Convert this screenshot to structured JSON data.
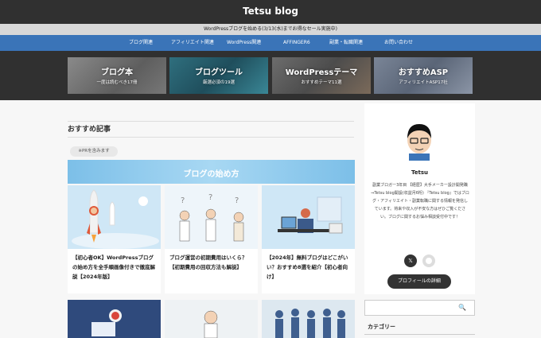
{
  "header": {
    "site_title": "Tetsu blog"
  },
  "sale_banner": "WordPressブログを始める(3/13(水)までお得なセール実施中)",
  "nav": [
    "ブログ関連",
    "アフィリエイト関連",
    "WordPress関連",
    "AFFINGER6",
    "副業・転職関連",
    "お問い合わせ"
  ],
  "hero_cards": [
    {
      "title": "ブログ本",
      "sub": "一度は読むべき17冊"
    },
    {
      "title": "ブログツール",
      "sub": "厳選必須の19選"
    },
    {
      "title": "WordPressテーマ",
      "sub": "おすすめテーマ11選"
    },
    {
      "title": "おすすめASP",
      "sub": "アフィリエイトASP17社"
    }
  ],
  "section": {
    "title": "おすすめ記事",
    "pr_tag": "※PRを含みます"
  },
  "banner": {
    "title": "ブログの始め方"
  },
  "articles": [
    {
      "title": "【初心者OK】WordPressブログの始め方を全手順画像付きで徹底解説【2024年版】"
    },
    {
      "title": "ブログ運営の初期費用はいくら？【初期費用の回収方法も解説】"
    },
    {
      "title": "【2024年】無料ブログはどこがいい？おすすめ8選を紹介【初心者向け】"
    }
  ],
  "sidebar": {
    "author": "Tetsu",
    "bio": "副業ブロガー3年目 【経歴】大手メーカー設計開発職⇒Tetsu blog開設(収益月6桁) 『Tetsu blog』ではブログ・アフィリエイト・副業転職に関する情報を発信しています。将来や収入が不安な方はぜひご覧ください。ブログに関するお悩み相談受付中です！",
    "social_x": "𝕏",
    "profile_button": "プロフィールの詳細"
  },
  "search": {
    "placeholder": ""
  },
  "category_label": "カテゴリー",
  "colors": {
    "header": "#303030",
    "nav": "#3a74b8",
    "accent": "#7cbfe8"
  }
}
